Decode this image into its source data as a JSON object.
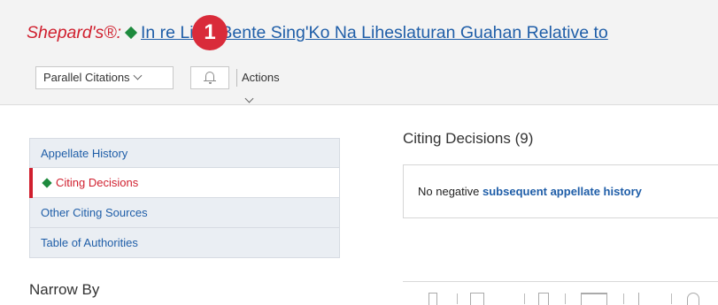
{
  "header": {
    "shepards_label": "Shepard's®:",
    "case_title": "In re Lina' Bente Sing'Ko Na Liheslaturan Guahan Relative to",
    "callout_number": "1"
  },
  "toolbar": {
    "parallel_citations_label": "Parallel Citations",
    "actions_label": "Actions"
  },
  "sidebar": {
    "items": [
      {
        "label": "Appellate History"
      },
      {
        "label": "Citing Decisions"
      },
      {
        "label": "Other Citing Sources"
      },
      {
        "label": "Table of Authorities"
      }
    ],
    "narrow_by": "Narrow By"
  },
  "main": {
    "section_title": "Citing Decisions (9)",
    "notice_text": "No negative",
    "notice_link": "subsequent appellate history"
  },
  "colors": {
    "accent_red": "#d01f2e",
    "link_blue": "#1f5ea8",
    "positive_green": "#1d8a3d"
  }
}
